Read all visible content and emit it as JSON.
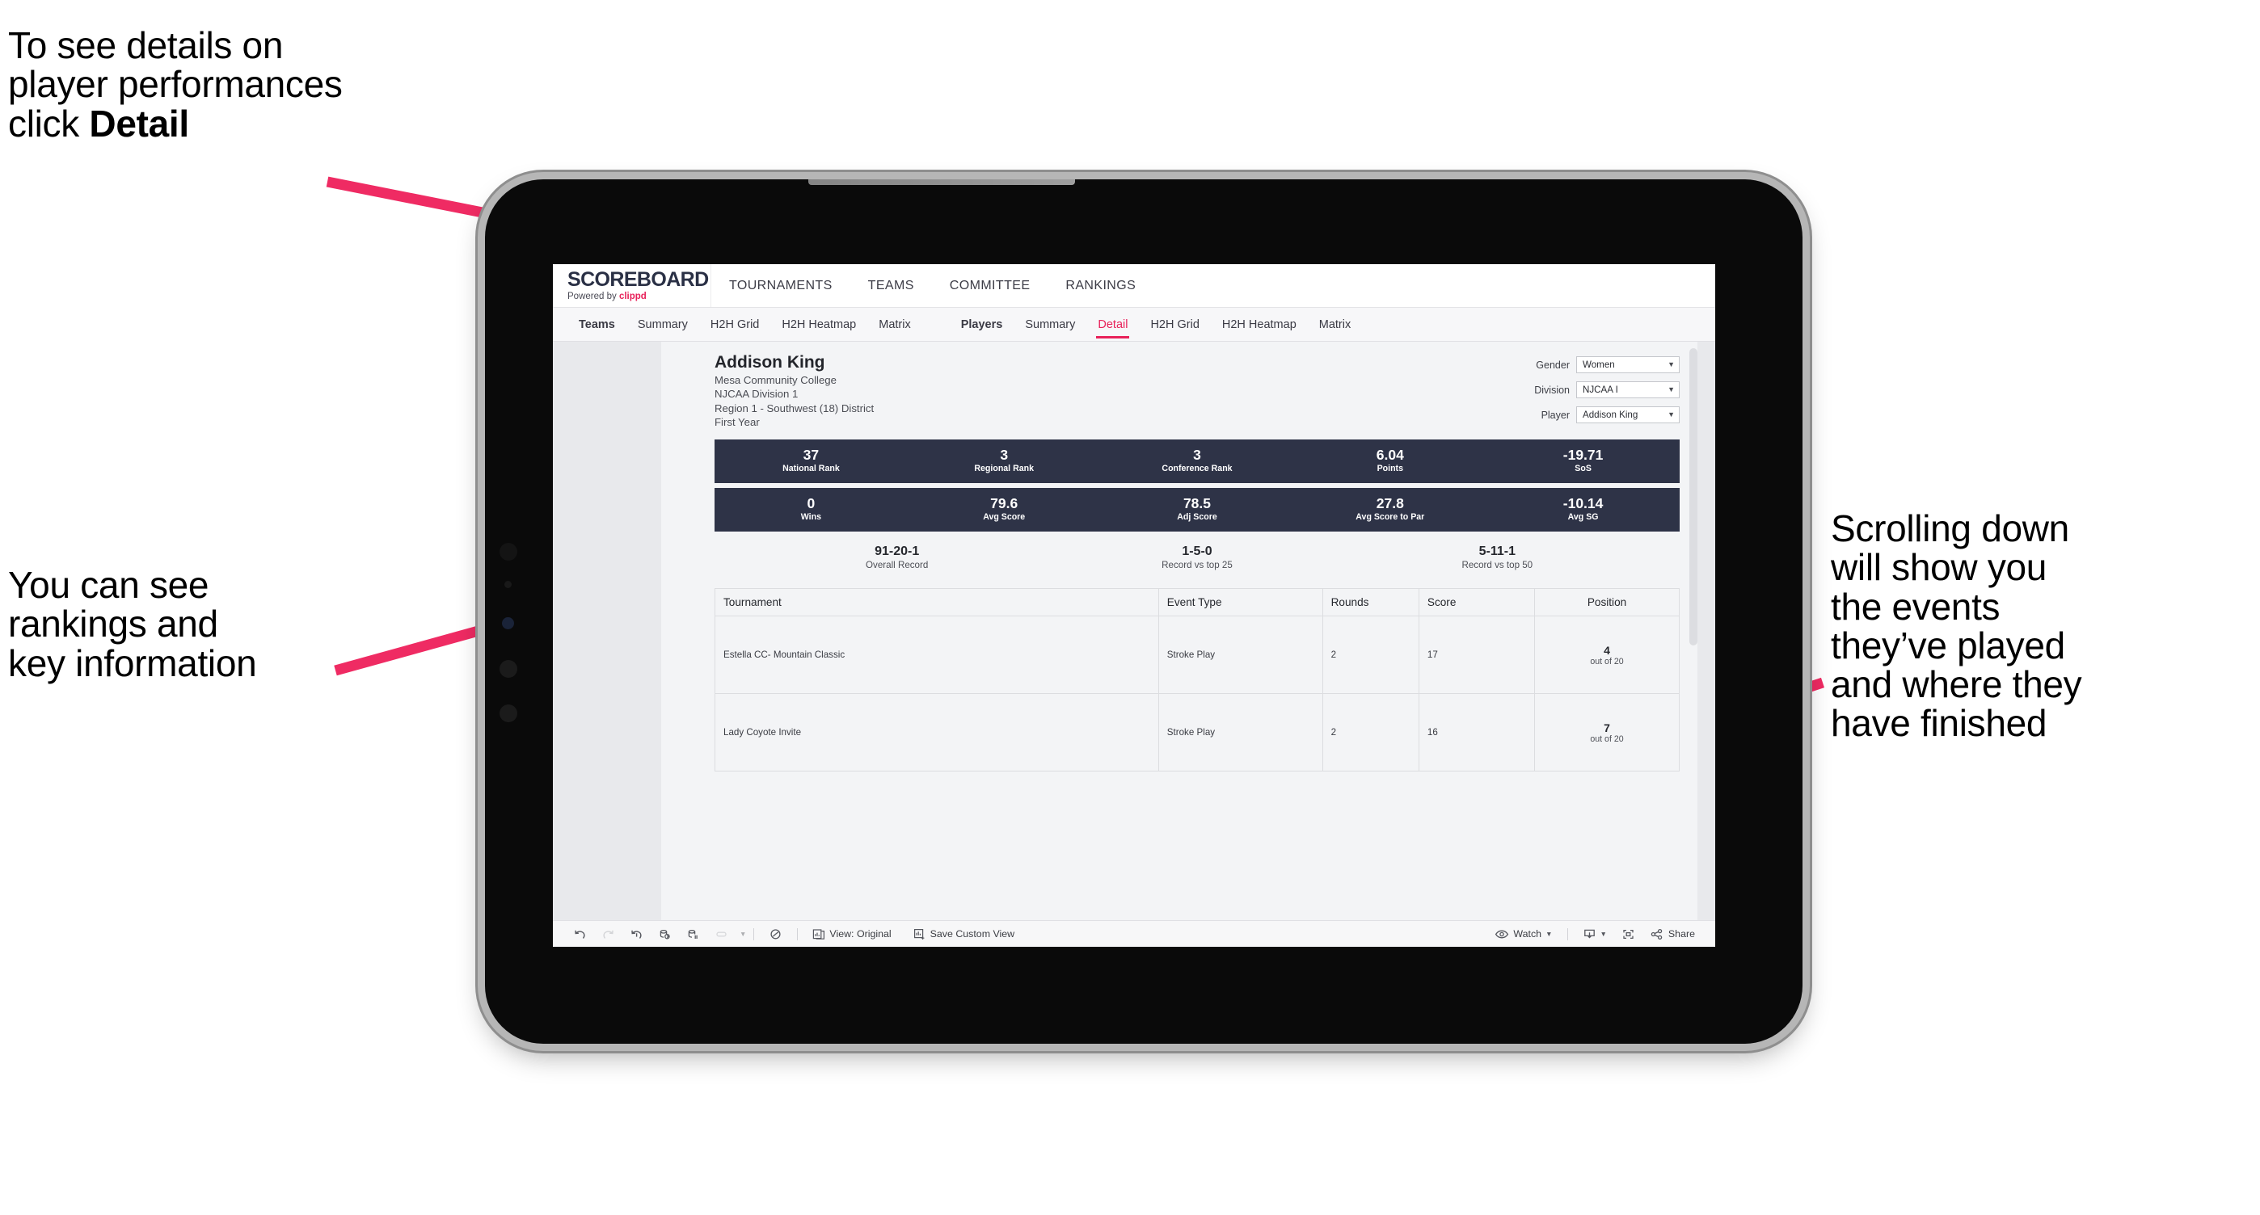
{
  "annotations": {
    "top_left_lines": [
      "To see details on",
      "player performances",
      "click "
    ],
    "top_left_bold": "Detail",
    "mid_left": "You can see\nrankings and\nkey information",
    "right": "Scrolling down\nwill show you\nthe events\nthey’ve played\nand where they\nhave finished",
    "arrow_color": "#ef2b63"
  },
  "app": {
    "logo": {
      "title": "SCOREBOARD",
      "powered_prefix": "Powered by ",
      "brand": "clippd"
    },
    "topnav": [
      "TOURNAMENTS",
      "TEAMS",
      "COMMITTEE",
      "RANKINGS"
    ],
    "subnav": {
      "teams_group": [
        "Teams",
        "Summary",
        "H2H Grid",
        "H2H Heatmap",
        "Matrix"
      ],
      "players_group": [
        "Players",
        "Summary",
        "Detail",
        "H2H Grid",
        "H2H Heatmap",
        "Matrix"
      ],
      "active": "Detail"
    }
  },
  "player": {
    "name": "Addison King",
    "school": "Mesa Community College",
    "division": "NJCAA Division 1",
    "region": "Region 1 - Southwest (18) District",
    "year": "First Year"
  },
  "filters": [
    {
      "label": "Gender",
      "value": "Women"
    },
    {
      "label": "Division",
      "value": "NJCAA I"
    },
    {
      "label": "Player",
      "value": "Addison King"
    }
  ],
  "stats_row1": [
    {
      "value": "37",
      "label": "National Rank"
    },
    {
      "value": "3",
      "label": "Regional Rank"
    },
    {
      "value": "3",
      "label": "Conference Rank"
    },
    {
      "value": "6.04",
      "label": "Points"
    },
    {
      "value": "-19.71",
      "label": "SoS"
    }
  ],
  "stats_row2": [
    {
      "value": "0",
      "label": "Wins"
    },
    {
      "value": "79.6",
      "label": "Avg Score"
    },
    {
      "value": "78.5",
      "label": "Adj Score"
    },
    {
      "value": "27.8",
      "label": "Avg Score to Par"
    },
    {
      "value": "-10.14",
      "label": "Avg SG"
    }
  ],
  "records": [
    {
      "value": "91-20-1",
      "label": "Overall Record"
    },
    {
      "value": "1-5-0",
      "label": "Record vs top 25"
    },
    {
      "value": "5-11-1",
      "label": "Record vs top 50"
    }
  ],
  "table": {
    "columns": [
      "Tournament",
      "Event Type",
      "Rounds",
      "Score",
      "Position"
    ],
    "rows": [
      {
        "tournament": "Estella CC- Mountain Classic",
        "event_type": "Stroke Play",
        "rounds": "2",
        "score": "17",
        "position": "4",
        "position_out_of": "out of 20"
      },
      {
        "tournament": "Lady Coyote Invite",
        "event_type": "Stroke Play",
        "rounds": "2",
        "score": "16",
        "position": "7",
        "position_out_of": "out of 20"
      }
    ]
  },
  "toolbar": {
    "view_label": "View: Original",
    "save_label": "Save Custom View",
    "watch_label": "Watch",
    "share_label": "Share"
  },
  "colors": {
    "accent_pink": "#e8215a",
    "stat_navy": "#2e3347",
    "logo_navy": "#2a3045"
  }
}
